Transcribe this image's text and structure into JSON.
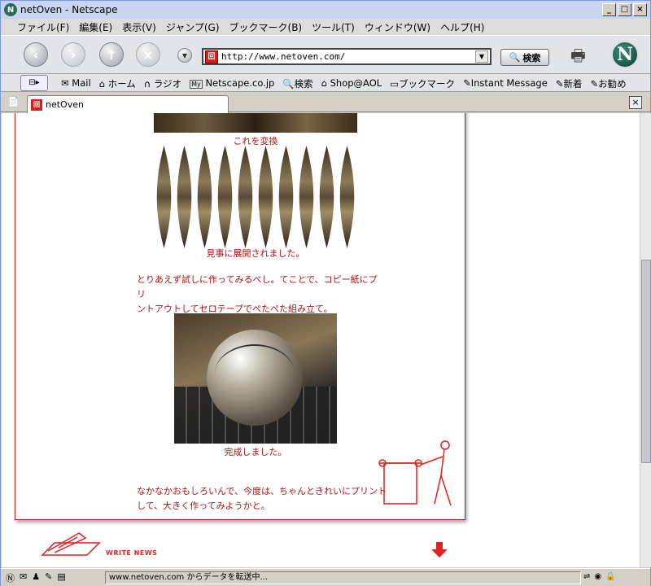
{
  "window": {
    "title": "netOven - Netscape"
  },
  "menu": [
    "ファイル(F)",
    "編集(E)",
    "表示(V)",
    "ジャンプ(G)",
    "ブックマーク(B)",
    "ツール(T)",
    "ウィンドウ(W)",
    "ヘルプ(H)"
  ],
  "nav": {
    "url": "http://www.netoven.com/",
    "search_label": "検索"
  },
  "bookmarks": [
    "Mail",
    "ホーム",
    "ラジオ",
    "Netscape.co.jp",
    "検索",
    "Shop@AOL",
    "ブックマーク",
    "Instant Message",
    "新着",
    "お勧め"
  ],
  "tab": {
    "label": "netOven"
  },
  "page": {
    "caption1": "これを変換",
    "caption2": "見事に展開されました。",
    "para1_line1": "とりあえず試しに作ってみるべし。てことで、コピー紙にプリ",
    "para1_line2": "ントアウトしてセロテープでぺたぺた組み立て。",
    "caption3": "完成しました。",
    "para2_line1": "なかなかおもしろいんで、今度は、ちゃんときれいにプリント",
    "para2_line2": "して、大きく作ってみようかと。",
    "write_news": "WRITE NEWS"
  },
  "status": {
    "text": "www.netoven.com からデータを転送中..."
  },
  "colors": {
    "accent": "#aa1414",
    "logo_red": "#e02020"
  }
}
